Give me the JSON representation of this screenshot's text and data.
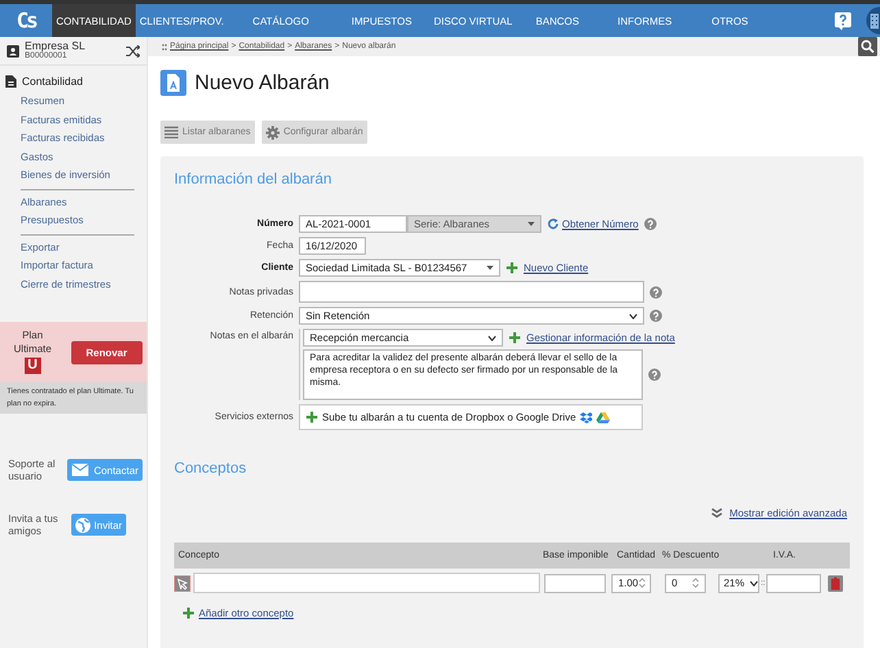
{
  "nav": {
    "logo": "Cs",
    "items": [
      {
        "label": "CONTABILIDAD",
        "selected": true
      },
      {
        "label": "CLIENTES/PROV.",
        "selected": false
      },
      {
        "label": "CATÁLOGO",
        "selected": false
      },
      {
        "label": "IMPUESTOS",
        "selected": false
      },
      {
        "label": "DISCO VIRTUAL",
        "selected": false
      },
      {
        "label": "BANCOS",
        "selected": false
      },
      {
        "label": "INFORMES",
        "selected": false
      },
      {
        "label": "OTROS",
        "selected": false
      }
    ]
  },
  "company": {
    "name": "Empresa SL",
    "id": "B00000001"
  },
  "breadcrumb": {
    "links": [
      "Página principal",
      "Contabilidad",
      "Albaranes"
    ],
    "separator": ">",
    "current": "Nuevo albarán"
  },
  "sidebar": {
    "section": "Contabilidad",
    "groups": [
      [
        "Resumen",
        "Facturas emitidas",
        "Facturas recibidas",
        "Gastos",
        "Bienes de inversión"
      ],
      [
        "Albaranes",
        "Presupuestos"
      ],
      [
        "Exportar",
        "Importar factura",
        "Cierre de trimestres"
      ]
    ]
  },
  "plan": {
    "label": [
      "Plan",
      "Ultimate"
    ],
    "badge": "U",
    "button": "Renovar",
    "note": "Tienes contratado el plan Ultimate. Tu plan no expira."
  },
  "support": [
    {
      "label": "Soporte al usuario",
      "button": "Contactar",
      "kind": "mail"
    },
    {
      "label": "Invita a tus amigos",
      "button": "Invitar",
      "kind": "globe"
    }
  ],
  "page": {
    "title": "Nuevo Albarán",
    "actions": [
      {
        "label": "Listar albaranes",
        "kind": "list"
      },
      {
        "label": "Configurar albarán",
        "kind": "gear"
      }
    ]
  },
  "info": {
    "heading": "Información del albarán",
    "numero": {
      "label": "Número",
      "required": true,
      "value": "AL-2021-0001",
      "series": "Serie: Albaranes",
      "link": "Obtener Número"
    },
    "fecha": {
      "label": "Fecha",
      "required": false,
      "value": "16/12/2020"
    },
    "cliente": {
      "label": "Cliente",
      "required": true,
      "value": "Sociedad Limitada SL - B01234567",
      "link": "Nuevo Cliente"
    },
    "notas_privadas": {
      "label": "Notas privadas",
      "required": false
    },
    "retencion": {
      "label": "Retención",
      "required": false,
      "value": "Sin Retención"
    },
    "notas_albaran": {
      "label": "Notas en el albarán",
      "required": false,
      "value": "Recepción mercancia",
      "link": "Gestionar información de la nota",
      "text": "Para acreditar la validez del presente albarán deberá llevar el sello de la empresa receptora o en su defecto ser firmado por un responsable de la misma."
    },
    "servicios": {
      "label": "Servicios externos",
      "required": false,
      "text": "Sube tu albarán a tu cuenta de Dropbox o Google Drive"
    }
  },
  "conceptos": {
    "heading": "Conceptos",
    "advanced_link": "Mostrar edición avanzada",
    "columns": [
      "Concepto",
      "Base imponible",
      "Cantidad",
      "% Descuento",
      "I.V.A."
    ],
    "row": {
      "cantidad": "1.00",
      "descuento": "0",
      "iva": "21%",
      "separator": "::"
    },
    "add_link": "Añadir otro concepto"
  }
}
